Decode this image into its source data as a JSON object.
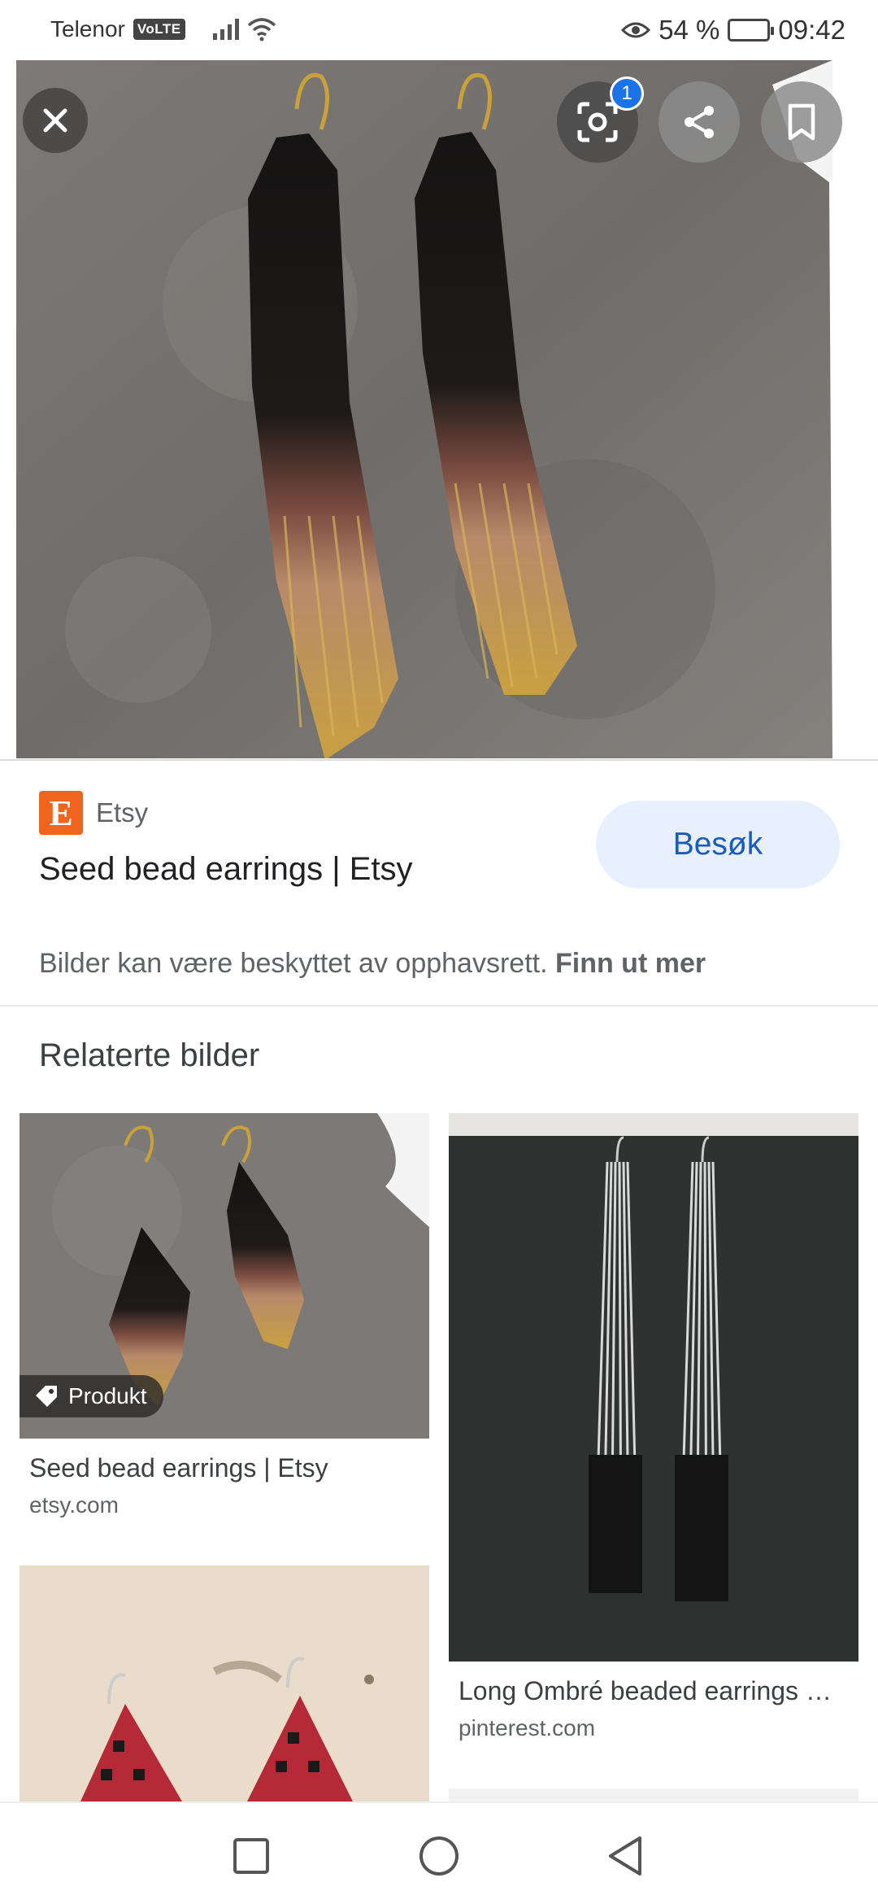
{
  "status_bar": {
    "carrier": "Telenor",
    "volte": "VoLTE",
    "battery_percent": "54 %",
    "battery_level": 0.54,
    "time": "09:42"
  },
  "viewer": {
    "lens_badge": "1",
    "icons": [
      "close-icon",
      "lens-icon",
      "share-icon",
      "bookmark-icon"
    ]
  },
  "result": {
    "source_name": "Etsy",
    "source_logo_letter": "E",
    "title": "Seed bead earrings | Etsy",
    "visit_label": "Besøk",
    "copyright_text": "Bilder kan være beskyttet av opphavsrett.",
    "learn_more": "Finn ut mer"
  },
  "related": {
    "heading": "Relaterte bilder",
    "items": [
      {
        "title": "Seed bead earrings | Etsy",
        "domain": "etsy.com",
        "tag": "Produkt"
      },
      {
        "title": "Long Ombré beaded earrings …",
        "domain": "pinterest.com"
      }
    ]
  },
  "colors": {
    "accent": "#1a73e8",
    "visit_bg": "#e8f0fe",
    "etsy_orange": "#f1641e"
  }
}
